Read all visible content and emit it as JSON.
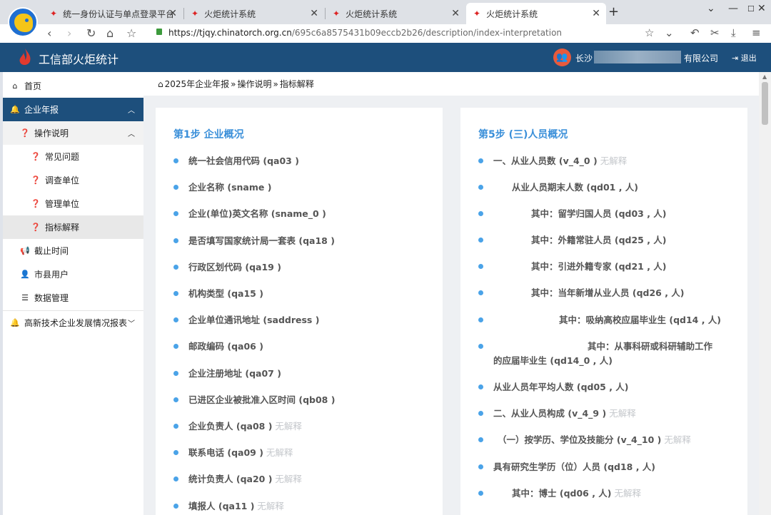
{
  "browser": {
    "tabs": [
      {
        "title": "统一身份认证与单点登录平台",
        "active": false
      },
      {
        "title": "火炬统计系统",
        "active": false
      },
      {
        "title": "火炬统计系统",
        "active": false
      },
      {
        "title": "火炬统计系统",
        "active": true
      }
    ],
    "url_host": "https://tjqy.chinatorch.org.cn",
    "url_path": "/695c6a8575431b09eccb2b26/description/index-interpretation"
  },
  "header": {
    "app_title": "工信部火炬统计",
    "user_prefix": "长沙",
    "user_suffix": "有限公司",
    "logout_label": "退出"
  },
  "sidebar": {
    "items": [
      {
        "label": "首页",
        "icon": "home-icon"
      },
      {
        "label": "企业年报",
        "icon": "bell-icon"
      },
      {
        "label": "操作说明",
        "icon": "question-circle-icon"
      },
      {
        "label": "常见问题",
        "icon": "question-circle-icon"
      },
      {
        "label": "调查单位",
        "icon": "question-circle-icon"
      },
      {
        "label": "管理单位",
        "icon": "question-circle-icon"
      },
      {
        "label": "指标解释",
        "icon": "question-circle-icon"
      },
      {
        "label": "截止时间",
        "icon": "megaphone-icon"
      },
      {
        "label": "市县用户",
        "icon": "user-icon"
      },
      {
        "label": "数据管理",
        "icon": "list-icon"
      },
      {
        "label": "高新技术企业发展情况报表",
        "icon": "bell-icon"
      }
    ]
  },
  "breadcrumb": {
    "items": [
      "2025年企业年报",
      "操作说明",
      "指标解释"
    ]
  },
  "left_card": {
    "title": "第1步 企业概况",
    "items": [
      {
        "text": "统一社会信用代码 (qa03 )",
        "note": ""
      },
      {
        "text": "企业名称 (sname )",
        "note": ""
      },
      {
        "text": "企业(单位)英文名称 (sname_0 )",
        "note": ""
      },
      {
        "text": "是否填写国家统计局一套表 (qa18 )",
        "note": ""
      },
      {
        "text": "行政区划代码 (qa19 )",
        "note": ""
      },
      {
        "text": "机构类型 (qa15 )",
        "note": ""
      },
      {
        "text": "企业单位通讯地址 (saddress )",
        "note": ""
      },
      {
        "text": "邮政编码 (qa06 )",
        "note": ""
      },
      {
        "text": "企业注册地址 (qa07 )",
        "note": ""
      },
      {
        "text": "已进区企业被批准入区时间 (qb08 )",
        "note": ""
      },
      {
        "text": "企业负责人 (qa08 )",
        "note": "无解释"
      },
      {
        "text": "联系电话 (qa09 )",
        "note": "无解释"
      },
      {
        "text": "统计负责人 (qa20 )",
        "note": "无解释"
      },
      {
        "text": "填报人 (qa11 )",
        "note": "无解释"
      }
    ]
  },
  "right_card": {
    "title": "第5步 (三)人员概况",
    "items": [
      {
        "text": "一、从业人员数 (v_4_0 )",
        "note": "无解释"
      },
      {
        "text": "从业人员期末人数 (qd01 , 人)",
        "note": ""
      },
      {
        "text": "其中：留学归国人员 (qd03 , 人)",
        "note": ""
      },
      {
        "text": "其中：外籍常驻人员 (qd25 , 人)",
        "note": ""
      },
      {
        "text": "其中：引进外籍专家 (qd21 , 人)",
        "note": ""
      },
      {
        "text": "其中：当年新增从业人员 (qd26 , 人)",
        "note": ""
      },
      {
        "text": "其中：吸纳高校应届毕业生 (qd14 , 人)",
        "note": ""
      },
      {
        "text": "其中：从事科研或科研辅助工作",
        "note": ""
      },
      {
        "text": "的应届毕业生 (qd14_0 , 人)",
        "note": ""
      },
      {
        "text": "从业人员年平均人数 (qd05 , 人)",
        "note": ""
      },
      {
        "text": "二、从业人员构成 (v_4_9 )",
        "note": "无解释"
      },
      {
        "text": "（一）按学历、学位及技能分 (v_4_10 )",
        "note": "无解释"
      },
      {
        "text": "具有研究生学历（位）人员 (qd18 , 人)",
        "note": ""
      },
      {
        "text": "其中：博士 (qd06 , 人)",
        "note": "无解释"
      }
    ]
  },
  "colors": {
    "header_bg": "#1d4f7c",
    "accent": "#3a8fd9",
    "bullet": "#4aa3e8",
    "muted_note": "#c5c8cc"
  }
}
